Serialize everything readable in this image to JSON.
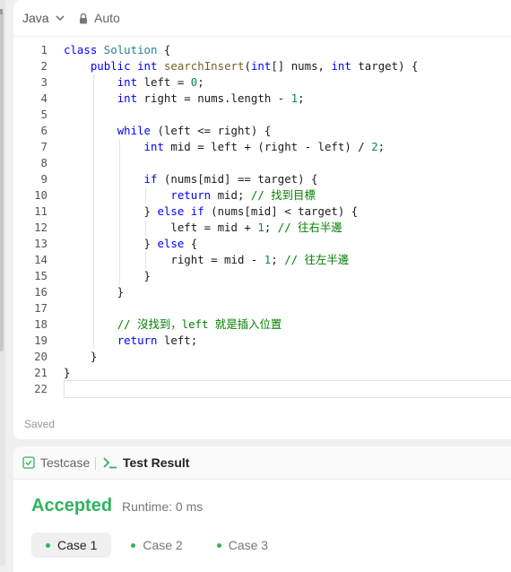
{
  "toolbar": {
    "language": "Java",
    "mode": "Auto"
  },
  "code_lines": [
    {
      "n": "1",
      "html": "<span class=\"k\">class</span> <span class=\"t\">Solution</span> {"
    },
    {
      "n": "2",
      "html": "    <span class=\"k\">public</span> <span class=\"k\">int</span> <span class=\"f\">searchInsert</span>(<span class=\"k\">int</span>[] nums, <span class=\"k\">int</span> target) {"
    },
    {
      "n": "3",
      "html": "        <span class=\"k\">int</span> left = <span class=\"n\">0</span>;"
    },
    {
      "n": "4",
      "html": "        <span class=\"k\">int</span> right = nums.length - <span class=\"n\">1</span>;"
    },
    {
      "n": "5",
      "html": ""
    },
    {
      "n": "6",
      "html": "        <span class=\"k\">while</span> (left &lt;= right) {"
    },
    {
      "n": "7",
      "html": "            <span class=\"k\">int</span> mid = left + (right - left) / <span class=\"n\">2</span>;"
    },
    {
      "n": "8",
      "html": ""
    },
    {
      "n": "9",
      "html": "            <span class=\"k\">if</span> (nums[mid] == target) {"
    },
    {
      "n": "10",
      "html": "                <span class=\"k\">return</span> mid; <span class=\"c\">// 找到目標</span>"
    },
    {
      "n": "11",
      "html": "            } <span class=\"k\">else</span> <span class=\"k\">if</span> (nums[mid] &lt; target) {"
    },
    {
      "n": "12",
      "html": "                left = mid + <span class=\"n\">1</span>; <span class=\"c\">// 往右半邊</span>"
    },
    {
      "n": "13",
      "html": "            } <span class=\"k\">else</span> {"
    },
    {
      "n": "14",
      "html": "                right = mid - <span class=\"n\">1</span>; <span class=\"c\">// 往左半邊</span>"
    },
    {
      "n": "15",
      "html": "            }"
    },
    {
      "n": "16",
      "html": "        }"
    },
    {
      "n": "17",
      "html": ""
    },
    {
      "n": "18",
      "html": "        <span class=\"c\">// 沒找到，left 就是插入位置</span>"
    },
    {
      "n": "19",
      "html": "        <span class=\"k\">return</span> left;"
    },
    {
      "n": "20",
      "html": "    }"
    },
    {
      "n": "21",
      "html": "}"
    },
    {
      "n": "22",
      "html": ""
    }
  ],
  "status": {
    "saved": "Saved"
  },
  "result_tabs": {
    "testcase": "Testcase",
    "test_result": "Test Result"
  },
  "result": {
    "verdict": "Accepted",
    "runtime": "Runtime: 0 ms",
    "cases": [
      "Case 1",
      "Case 2",
      "Case 3"
    ],
    "active_case": 0
  },
  "colors": {
    "accent_green": "#2db55d",
    "keyword": "#0000ff",
    "comment": "#008000",
    "number": "#098658"
  }
}
